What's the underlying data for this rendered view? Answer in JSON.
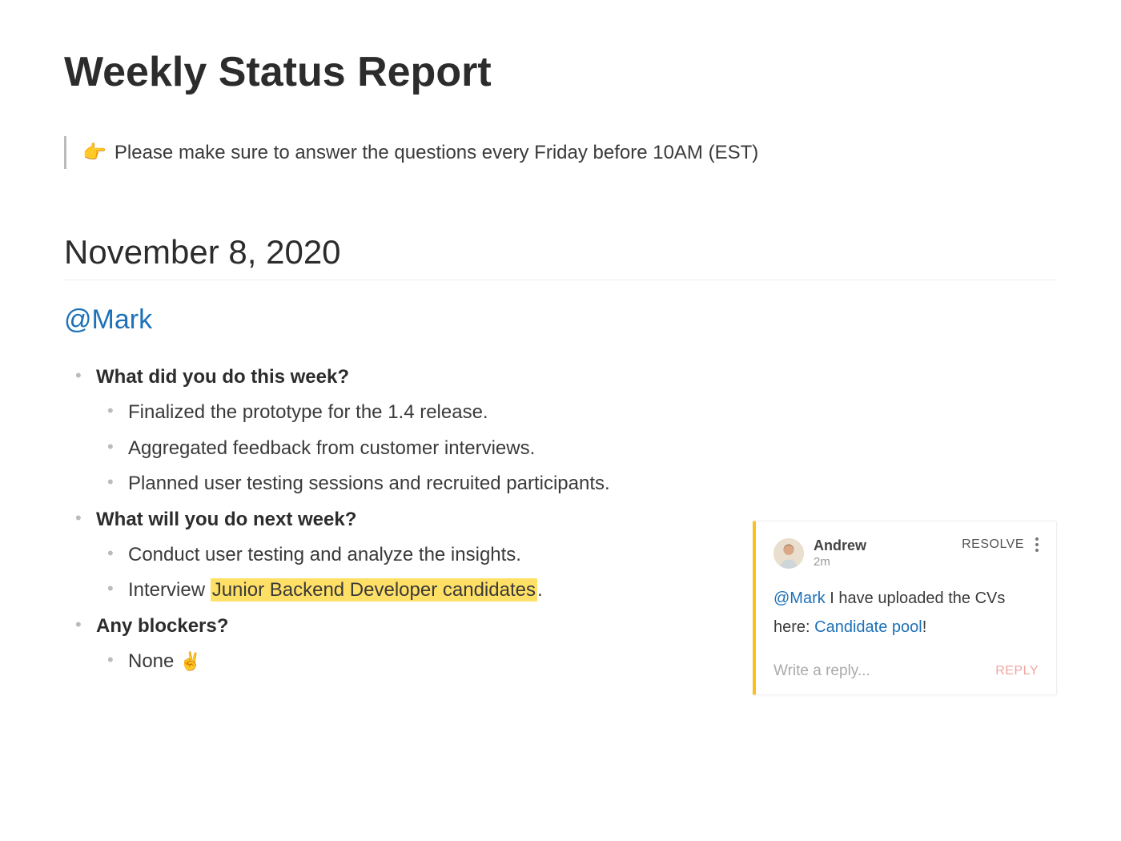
{
  "title": "Weekly Status Report",
  "callout": {
    "icon": "👉",
    "text": "Please make sure to answer the questions every Friday before 10AM (EST)"
  },
  "date": "November 8, 2020",
  "mention": "@Mark",
  "questions": {
    "q1": {
      "label": "What did you do this week?",
      "items": {
        "0": "Finalized the prototype for the 1.4 release.",
        "1": "Aggregated feedback from customer interviews.",
        "2": "Planned user testing sessions and recruited participants."
      }
    },
    "q2": {
      "label": "What will you do next week?",
      "items": {
        "0": "Conduct user testing and analyze the insights.",
        "1_prefix": "Interview ",
        "1_highlight": "Junior Backend Developer candidates",
        "1_suffix": "."
      }
    },
    "q3": {
      "label": "Any blockers?",
      "items": {
        "0_text": "None ",
        "0_icon": "✌️"
      }
    }
  },
  "comment": {
    "author": "Andrew",
    "time": "2m",
    "resolve_label": "RESOLVE",
    "body": {
      "mention": "@Mark",
      "text1": " I have uploaded the CVs here: ",
      "link": "Candidate pool",
      "text2": "!"
    },
    "reply_placeholder": "Write a reply...",
    "reply_label": "REPLY"
  }
}
